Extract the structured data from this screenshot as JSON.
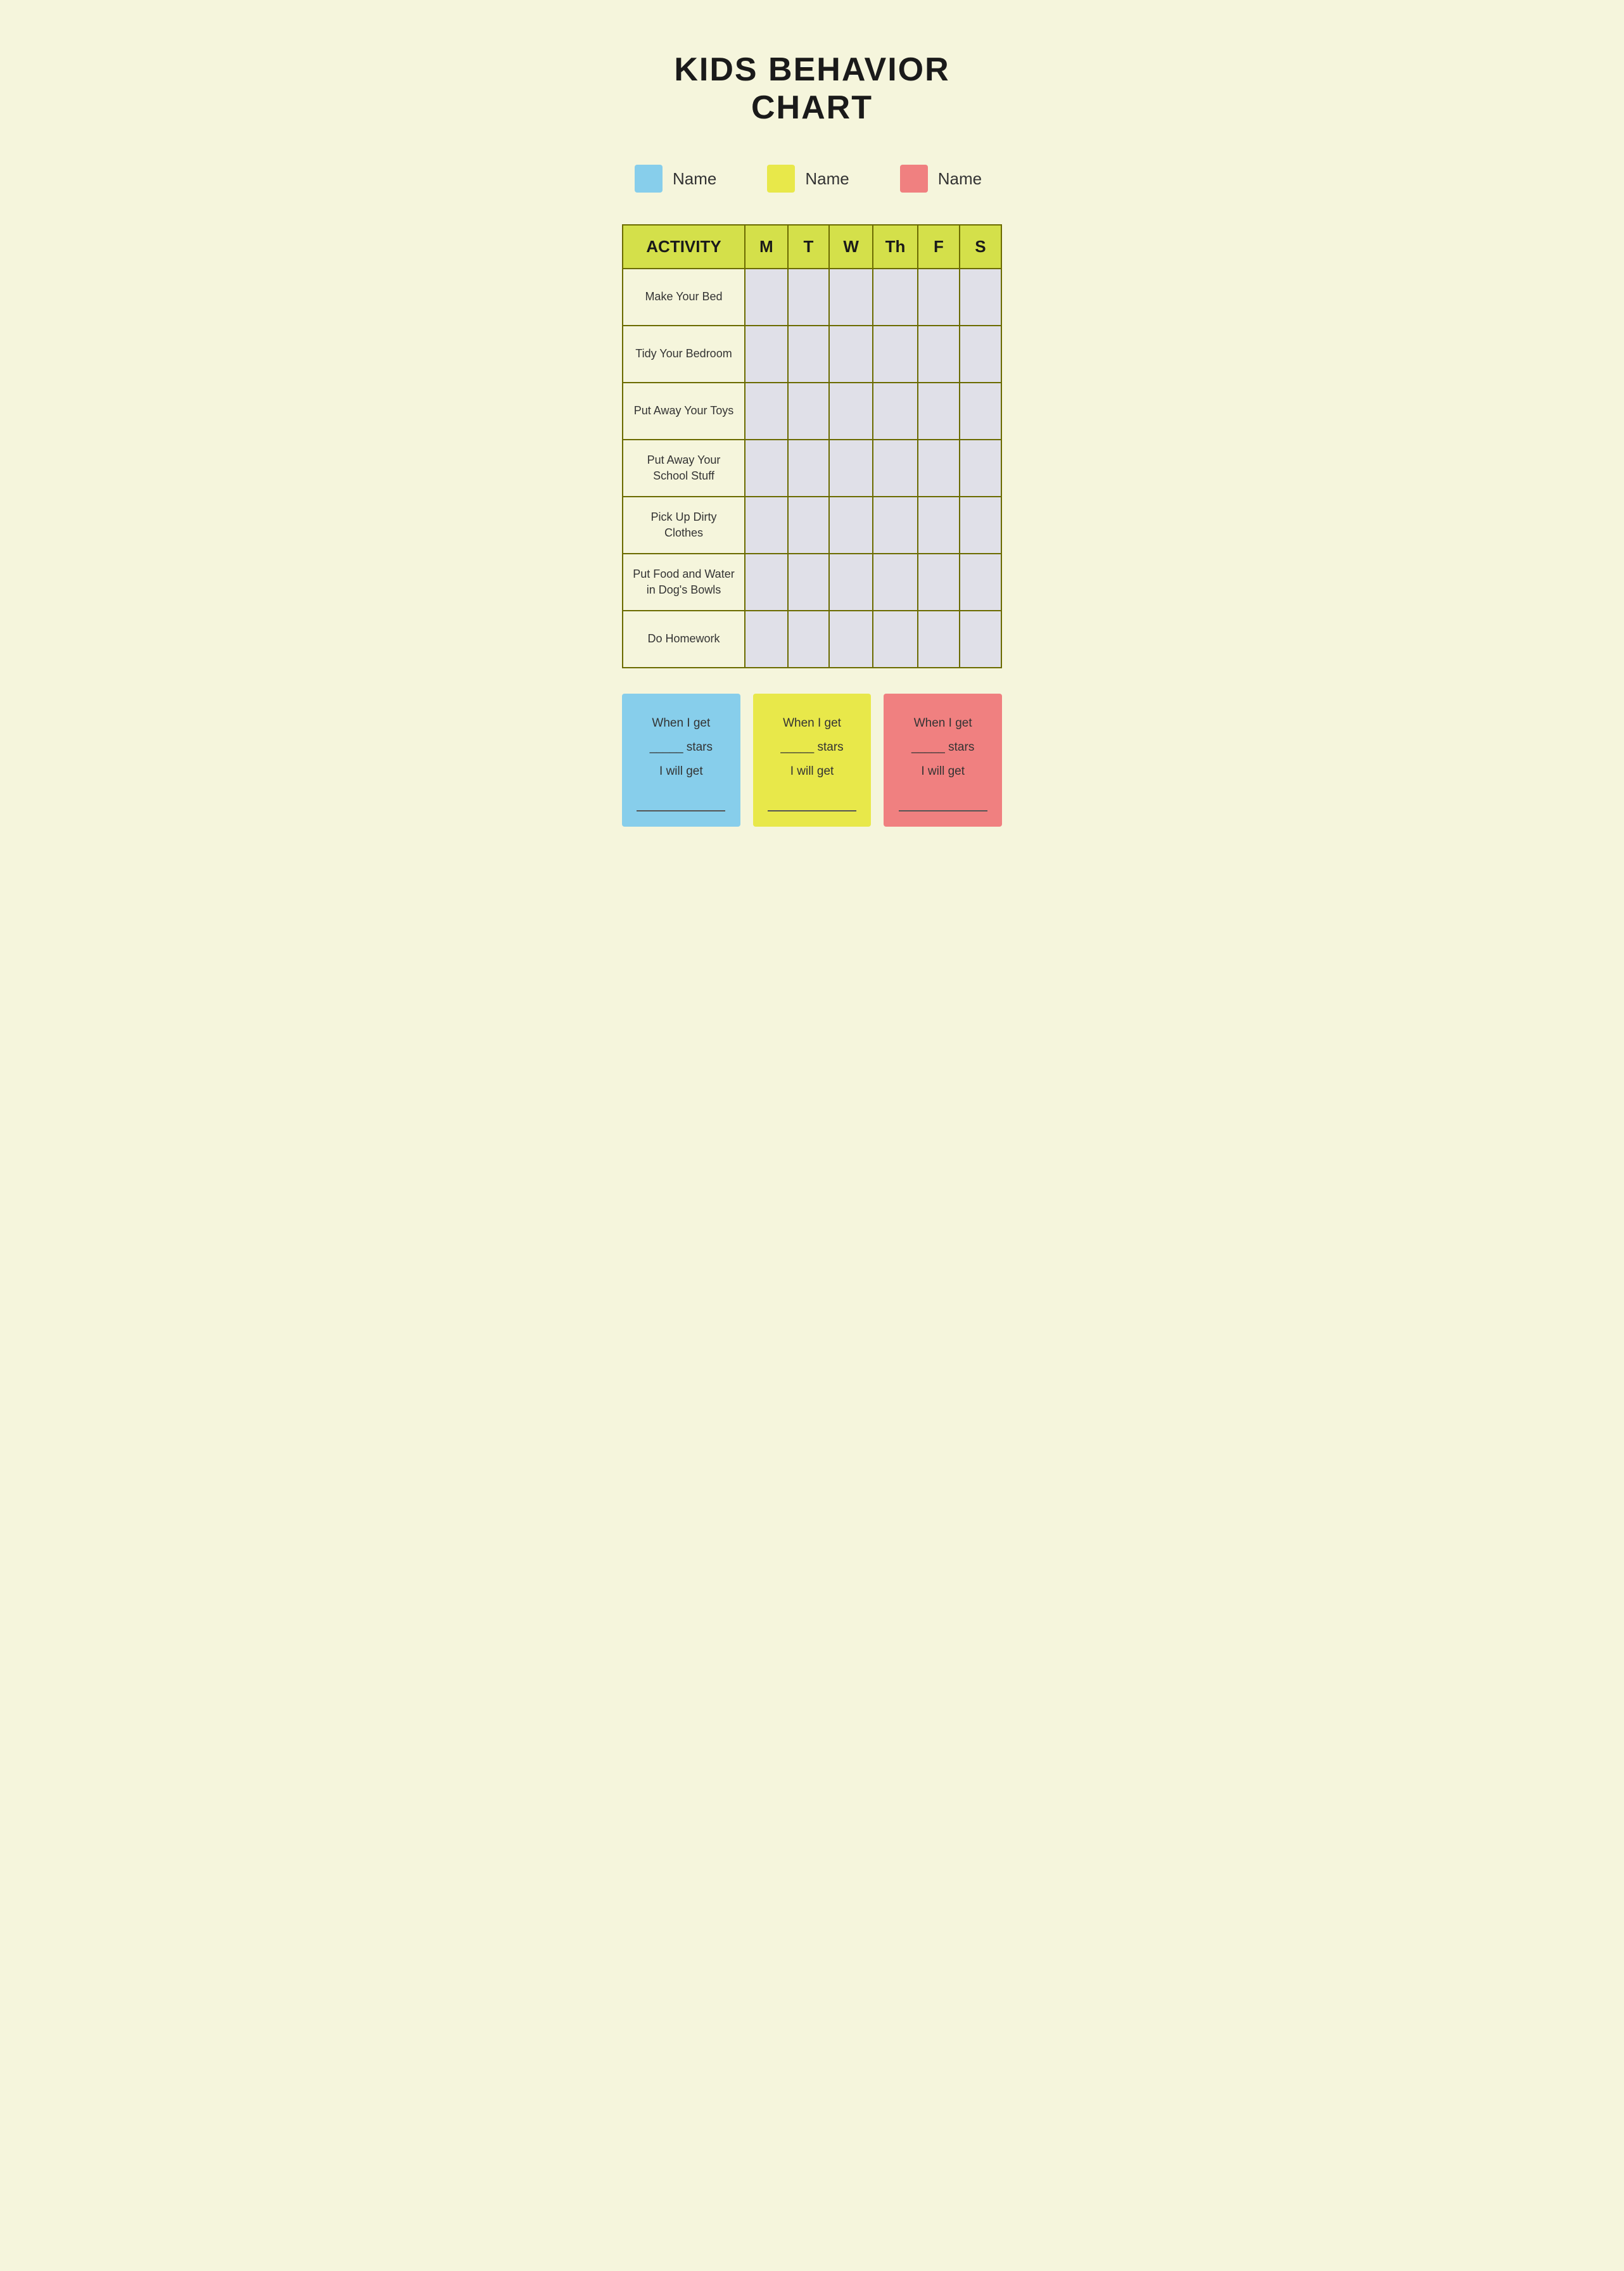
{
  "title": "KIDS BEHAVIOR CHART",
  "legend": [
    {
      "id": "blue",
      "color": "#87ceeb",
      "label": "Name"
    },
    {
      "id": "yellow",
      "color": "#e8e84a",
      "label": "Name"
    },
    {
      "id": "pink",
      "color": "#f08080",
      "label": "Name"
    }
  ],
  "table": {
    "header": {
      "activity": "ACTIVITY",
      "days": [
        "M",
        "T",
        "W",
        "Th",
        "F",
        "S"
      ]
    },
    "rows": [
      {
        "activity": "Make Your Bed"
      },
      {
        "activity": "Tidy Your Bedroom"
      },
      {
        "activity": "Put Away Your Toys"
      },
      {
        "activity": "Put Away Your School Stuff"
      },
      {
        "activity": "Pick Up Dirty Clothes"
      },
      {
        "activity": "Put Food and Water in Dog's Bowls"
      },
      {
        "activity": "Do Homework"
      }
    ]
  },
  "rewards": [
    {
      "id": "blue",
      "bg": "#87ceeb",
      "line1": "When I get",
      "line2": "_____ stars",
      "line3": "I will get",
      "line4": "_______________"
    },
    {
      "id": "yellow",
      "bg": "#e8e84a",
      "line1": "When I get",
      "line2": "_____ stars",
      "line3": "I will get",
      "line4": "_______________"
    },
    {
      "id": "pink",
      "bg": "#f08080",
      "line1": "When I get",
      "line2": "_____ stars",
      "line3": "I will get",
      "line4": "_______________"
    }
  ]
}
